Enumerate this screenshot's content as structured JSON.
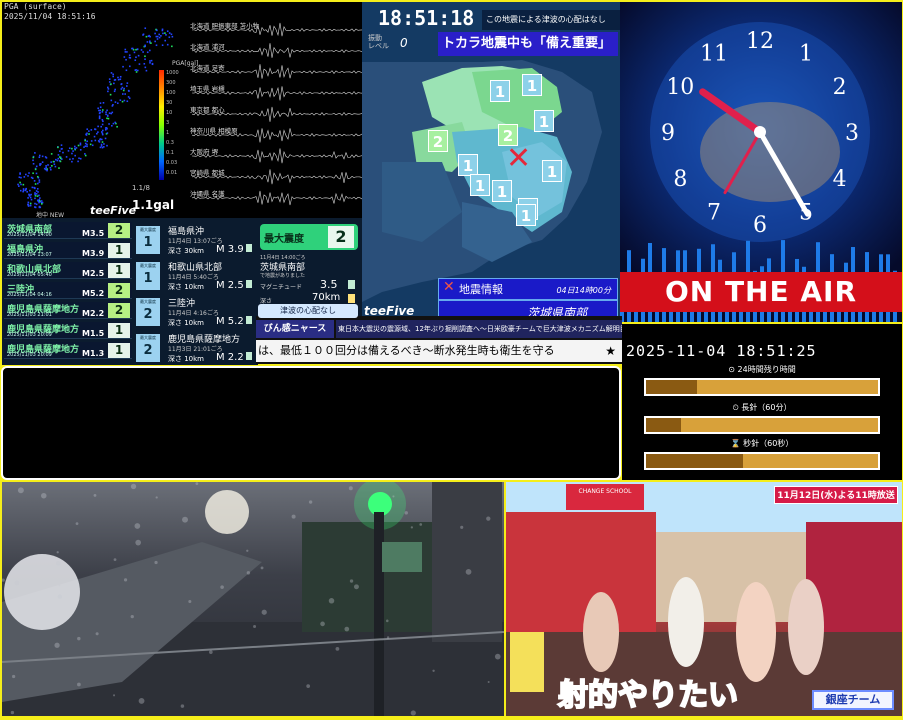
{
  "seismic": {
    "header_line1": "PGA (surface)",
    "header_line2": "2025/11/04 18:51:16",
    "scale_label": "PGA[gal]",
    "scale_ticks": [
      "1000",
      "300",
      "100",
      "30",
      "10",
      "3",
      "1",
      "0.3",
      "0.1",
      "0.03",
      "0.01"
    ],
    "gal_value": "1.1gal",
    "gal_small": "1.1/8",
    "wave_stations": [
      "北海道 胆振東部 苫小牧",
      "北海道 浦河",
      "北海道 足寄",
      "埼玉県 岩槻",
      "東京都 都心",
      "神奈川県 相模原",
      "大阪府 堺",
      "宮崎県 都城",
      "沖縄県 名護"
    ],
    "brand": "地中 NEW",
    "logo": "teeFive"
  },
  "quake_list": [
    {
      "name": "茨城県南部",
      "date": "2025/11/04 14:00",
      "mag": "M3.5",
      "intensity": "2"
    },
    {
      "name": "福島県沖",
      "date": "2025/11/04 13:07",
      "mag": "M3.9",
      "intensity": "1"
    },
    {
      "name": "和歌山県北部",
      "date": "2025/11/04 05:40",
      "mag": "M2.5",
      "intensity": "1"
    },
    {
      "name": "三陸沖",
      "date": "2025/11/04 04:16",
      "mag": "M5.2",
      "intensity": "2"
    },
    {
      "name": "鹿児島県薩摩地方",
      "date": "2025/11/03 21:01",
      "mag": "M2.2",
      "intensity": "2"
    },
    {
      "name": "鹿児島県薩摩地方",
      "date": "2025/11/03 20:09",
      "mag": "M1.5",
      "intensity": "1"
    },
    {
      "name": "鹿児島県薩摩地方",
      "date": "2025/11/03 20:09",
      "mag": "M1.3",
      "intensity": "1"
    }
  ],
  "quake_detail": [
    {
      "tag": "最大震度",
      "intensity": "1",
      "name": "福島県沖",
      "date": "11月4日 13:07ごろ",
      "depth": "深さ 30km",
      "mag": "M 3.9"
    },
    {
      "tag": "最大震度",
      "intensity": "1",
      "name": "和歌山県北部",
      "date": "11月4日 5:40ごろ",
      "depth": "深さ 10km",
      "mag": "M 2.5"
    },
    {
      "tag": "最大震度",
      "intensity": "2",
      "name": "三陸沖",
      "date": "11月4日 4:16ごろ",
      "depth": "深さ 10km",
      "mag": "M 5.2"
    },
    {
      "tag": "最大震度",
      "intensity": "2",
      "name": "鹿児島県薩摩地方",
      "date": "11月3日 21:01ごろ",
      "depth": "深さ 10km",
      "mag": "M 2.2"
    }
  ],
  "max_intensity": {
    "label": "最大震度",
    "value": "2",
    "time": "11月4日 14:00ごろ",
    "place": "茨城県南部",
    "note": "で地震がありました",
    "mag_label": "マグニチュード",
    "mag": "3.5",
    "depth_label": "深さ",
    "depth": "70km"
  },
  "region_map": {
    "clock": "18:51:18",
    "tsunami": "この地震による津波の心配はなし",
    "level_label": "振動\nレベル",
    "level_value": "0",
    "banner": "トカラ地震中も「備え重要」",
    "logo": "teeFive",
    "info_title": "地震情報",
    "info_time": "04日14時00分",
    "info_place": "茨城県南部",
    "markers": [
      "1",
      "1",
      "2",
      "2",
      "1",
      "1",
      "1",
      "1",
      "1",
      "1",
      "1"
    ]
  },
  "clock_panel": {
    "numbers": [
      "12",
      "1",
      "2",
      "3",
      "4",
      "5",
      "6",
      "7",
      "8",
      "9",
      "10",
      "11"
    ],
    "on_air": "ON THE AIR"
  },
  "ticker": {
    "tag": "びん感ニャース",
    "tsunami_tag": "津波の心配なし",
    "headline": "東日本大震災の震源域、12年ぶり掘削調査へ～日米欧豪チームで巨大津波メカニズム解明目指す",
    "scroll": "は、最低１００回分は備えるべき～断水発生時も衛生を守る",
    "star": "★"
  },
  "timers": {
    "datetime": "2025-11-04 18:51:25",
    "bars": [
      {
        "label": "24時間残り時間",
        "progress": 0.22
      },
      {
        "label": "長針（60分）",
        "progress": 0.15
      },
      {
        "label": "秒針（60秒）",
        "progress": 0.42
      }
    ]
  },
  "tv": {
    "caption": "射的やりたい",
    "corner": "11月12日(水)よる11時放送",
    "team": "銀座チーム",
    "shop_sign": "CHANGE SCHOOL"
  }
}
